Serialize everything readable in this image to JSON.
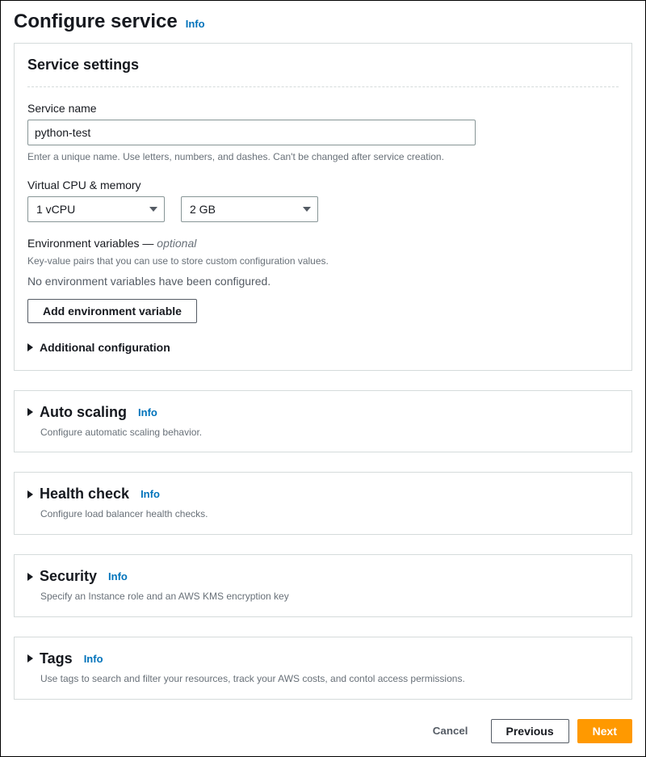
{
  "header": {
    "title": "Configure service",
    "info": "Info"
  },
  "settings": {
    "title": "Service settings",
    "service_name": {
      "label": "Service name",
      "value": "python-test",
      "helper": "Enter a unique name. Use letters, numbers, and dashes. Can't be changed after service creation."
    },
    "cpu_memory": {
      "label": "Virtual CPU & memory",
      "vcpu": "1 vCPU",
      "memory": "2 GB"
    },
    "env_vars": {
      "label_prefix": "Environment variables —",
      "label_suffix": "optional",
      "helper": "Key-value pairs that you can use to store custom configuration values.",
      "empty_text": "No environment variables have been configured.",
      "add_button": "Add environment variable"
    },
    "additional_config": "Additional configuration"
  },
  "sections": {
    "auto_scaling": {
      "title": "Auto scaling",
      "info": "Info",
      "desc": "Configure automatic scaling behavior."
    },
    "health_check": {
      "title": "Health check",
      "info": "Info",
      "desc": "Configure load balancer health checks."
    },
    "security": {
      "title": "Security",
      "info": "Info",
      "desc": "Specify an Instance role and an AWS KMS encryption key"
    },
    "tags": {
      "title": "Tags",
      "info": "Info",
      "desc": "Use tags to search and filter your resources, track your AWS costs, and contol access permissions."
    }
  },
  "footer": {
    "cancel": "Cancel",
    "previous": "Previous",
    "next": "Next"
  }
}
